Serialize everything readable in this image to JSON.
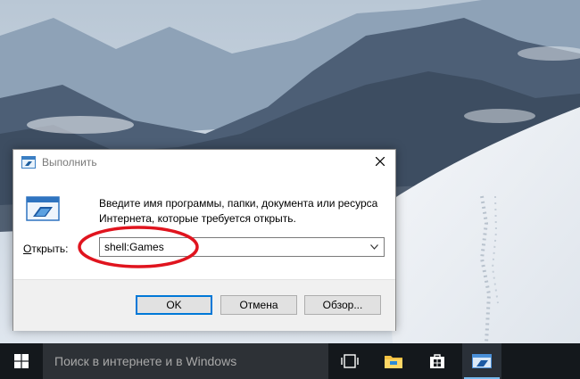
{
  "dialog": {
    "title": "Выполнить",
    "description": "Введите имя программы, папки, документа или ресурса Интернета, которые требуется открыть.",
    "open_label_accel": "О",
    "open_label_rest": "ткрыть:",
    "command_value": "shell:Games",
    "buttons": {
      "ok": "OK",
      "cancel": "Отмена",
      "browse": "Обзор..."
    }
  },
  "taskbar": {
    "search_placeholder": "Поиск в интернете и в Windows",
    "icons": [
      "windows-logo-icon",
      "task-view-icon",
      "file-explorer-icon",
      "store-icon",
      "run-dialog-icon"
    ]
  },
  "colors": {
    "accent": "#0078d7",
    "highlight_ellipse": "#e0141e",
    "taskbar": "#14181c"
  }
}
